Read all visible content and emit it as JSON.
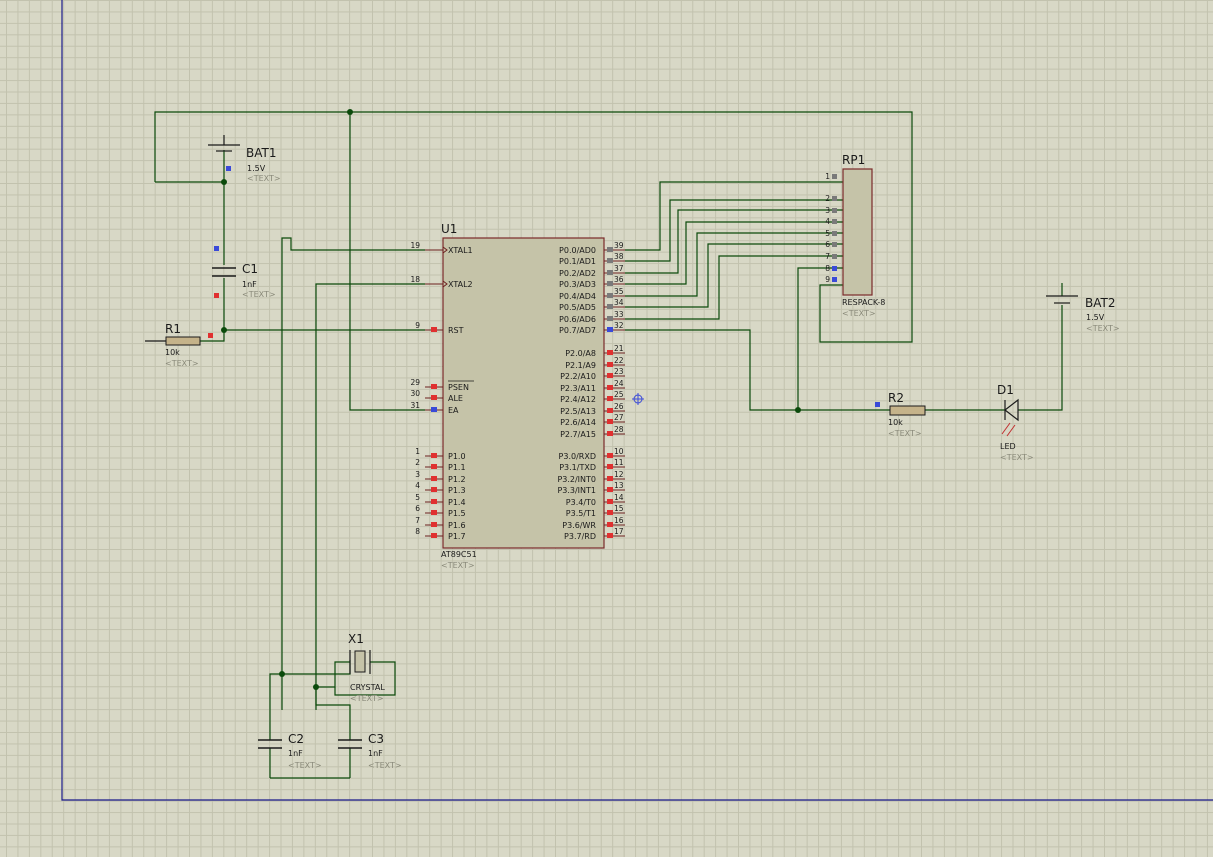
{
  "components": {
    "bat1": {
      "ref": "BAT1",
      "value": "1.5V",
      "text": "<TEXT>"
    },
    "bat2": {
      "ref": "BAT2",
      "value": "1.5V",
      "text": "<TEXT>"
    },
    "c1": {
      "ref": "C1",
      "value": "1nF",
      "text": "<TEXT>"
    },
    "c2": {
      "ref": "C2",
      "value": "1nF",
      "text": "<TEXT>"
    },
    "c3": {
      "ref": "C3",
      "value": "1nF",
      "text": "<TEXT>"
    },
    "r1": {
      "ref": "R1",
      "value": "10k",
      "text": "<TEXT>"
    },
    "r2": {
      "ref": "R2",
      "value": "10k",
      "text": "<TEXT>"
    },
    "d1": {
      "ref": "D1",
      "value": "LED",
      "text": "<TEXT>"
    },
    "x1": {
      "ref": "X1",
      "value": "CRYSTAL",
      "text": "<TEXT>"
    },
    "rp1": {
      "ref": "RP1",
      "value": "RESPACK-8",
      "text": "<TEXT>",
      "pins": [
        "1",
        "2",
        "3",
        "4",
        "5",
        "6",
        "7",
        "8",
        "9"
      ]
    },
    "u1": {
      "ref": "U1",
      "value": "AT89C51",
      "text": "<TEXT>",
      "left_pins": [
        {
          "num": "19",
          "label": "XTAL1"
        },
        {
          "num": "18",
          "label": "XTAL2"
        },
        {
          "num": "9",
          "label": "RST"
        },
        {
          "num": "29",
          "label": "PSEN"
        },
        {
          "num": "30",
          "label": "ALE"
        },
        {
          "num": "31",
          "label": "EA"
        },
        {
          "num": "1",
          "label": "P1.0"
        },
        {
          "num": "2",
          "label": "P1.1"
        },
        {
          "num": "3",
          "label": "P1.2"
        },
        {
          "num": "4",
          "label": "P1.3"
        },
        {
          "num": "5",
          "label": "P1.4"
        },
        {
          "num": "6",
          "label": "P1.5"
        },
        {
          "num": "7",
          "label": "P1.6"
        },
        {
          "num": "8",
          "label": "P1.7"
        }
      ],
      "right_pins": [
        {
          "num": "39",
          "label": "P0.0/AD0"
        },
        {
          "num": "38",
          "label": "P0.1/AD1"
        },
        {
          "num": "37",
          "label": "P0.2/AD2"
        },
        {
          "num": "36",
          "label": "P0.3/AD3"
        },
        {
          "num": "35",
          "label": "P0.4/AD4"
        },
        {
          "num": "34",
          "label": "P0.5/AD5"
        },
        {
          "num": "33",
          "label": "P0.6/AD6"
        },
        {
          "num": "32",
          "label": "P0.7/AD7"
        },
        {
          "num": "21",
          "label": "P2.0/A8"
        },
        {
          "num": "22",
          "label": "P2.1/A9"
        },
        {
          "num": "23",
          "label": "P2.2/A10"
        },
        {
          "num": "24",
          "label": "P2.3/A11"
        },
        {
          "num": "25",
          "label": "P2.4/A12"
        },
        {
          "num": "26",
          "label": "P2.5/A13"
        },
        {
          "num": "27",
          "label": "P2.6/A14"
        },
        {
          "num": "28",
          "label": "P2.7/A15"
        },
        {
          "num": "10",
          "label": "P3.0/RXD"
        },
        {
          "num": "11",
          "label": "P3.1/TXD"
        },
        {
          "num": "12",
          "label": "P3.2/INT0"
        },
        {
          "num": "13",
          "label": "P3.3/INT1"
        },
        {
          "num": "14",
          "label": "P3.4/T0"
        },
        {
          "num": "15",
          "label": "P3.5/T1"
        },
        {
          "num": "16",
          "label": "P3.6/WR"
        },
        {
          "num": "17",
          "label": "P3.7/RD"
        }
      ]
    }
  },
  "colors": {
    "grid_bg": "#d8d8c6",
    "wire": "#0b4a0b",
    "body": "#c5c3a8",
    "pin_outline": "#7a2a2a",
    "sheet_border": "#1a1a8a",
    "pin_marker_red": "#e03030",
    "pin_marker_blue": "#3a4ad8"
  }
}
